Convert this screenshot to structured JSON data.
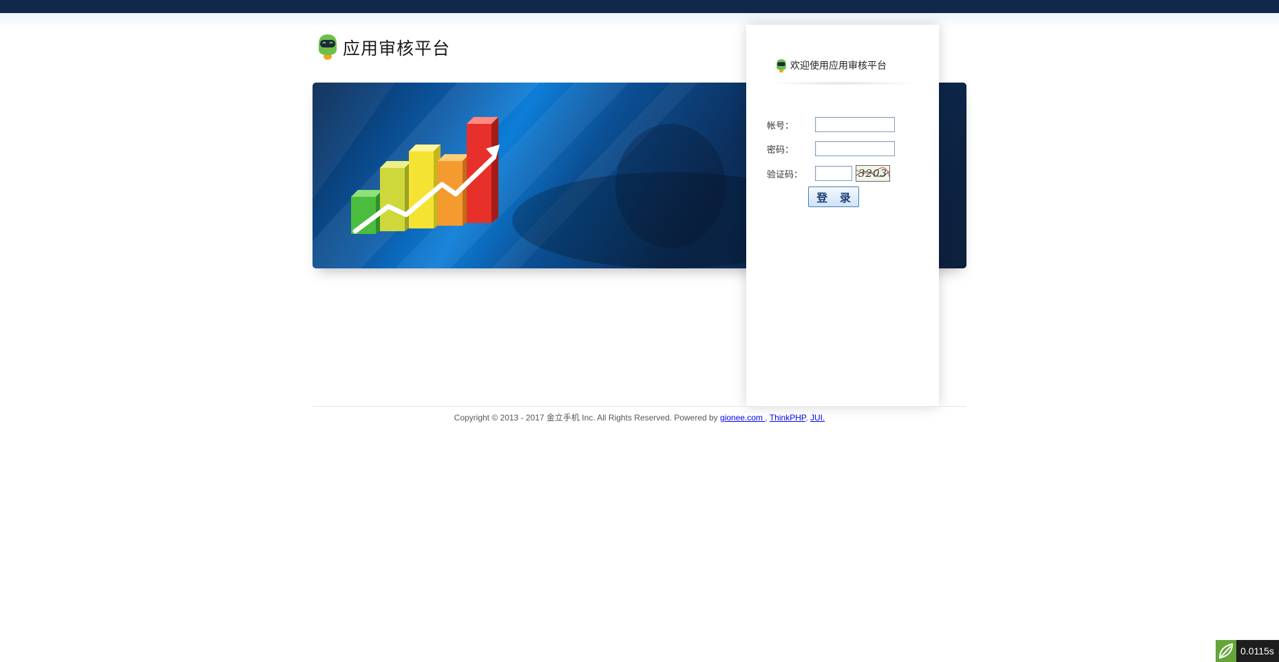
{
  "header": {
    "title": "应用审核平台"
  },
  "login": {
    "welcome": "欢迎使用应用审核平台",
    "account_label": "帐号：",
    "account_value": "",
    "password_label": "密码：",
    "password_value": "",
    "captcha_label": "验证码：",
    "captcha_value": "",
    "captcha_image_text": "3203",
    "submit_label": "登 录"
  },
  "footer": {
    "copyright": "Copyright © 2013 - 2017 金立手机 Inc. All Rights Reserved. Powered by ",
    "links": [
      {
        "label": "gionee.com "
      },
      {
        "label": "ThinkPHP"
      },
      {
        "label": "JUI."
      }
    ],
    "sep1": ", ",
    "sep2": ", "
  },
  "perf_badge": {
    "value": "0.0115s"
  },
  "colors": {
    "topbar": "#12284a",
    "brand_green": "#6cc04a",
    "link": "#0000ee"
  }
}
